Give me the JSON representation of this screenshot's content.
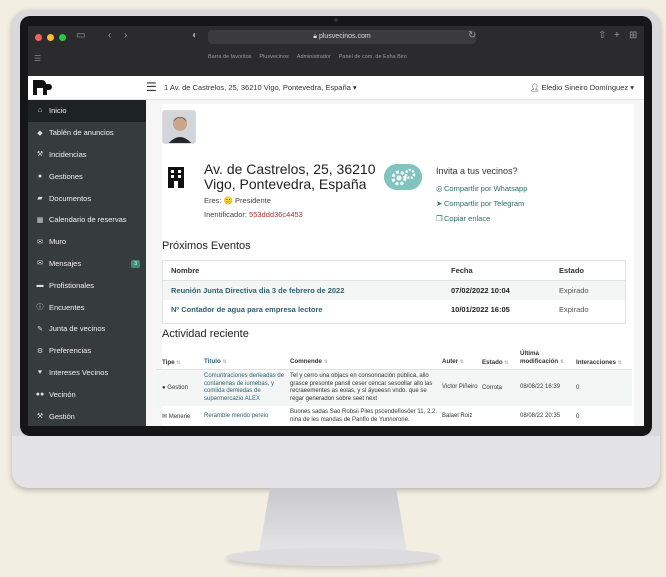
{
  "browser": {
    "url": "plusvecinos.com",
    "bookmarks": [
      "Barra de favoritos",
      "Plusvecinos",
      "Administrador",
      "Panel de com. de Esha Biro"
    ]
  },
  "topbar": {
    "address_selector": "1 Av. de Castrelos, 25, 36210 Vigo, Pontevedra, España",
    "user_name": "Eledio Sineiro Domínguez"
  },
  "sidebar": {
    "items": [
      {
        "label": "Inicio",
        "icon": "home-icon"
      },
      {
        "label": "Tablén de anuncios",
        "icon": "tag-icon"
      },
      {
        "label": "Incidencias",
        "icon": "wrench-icon"
      },
      {
        "label": "Gestiones",
        "icon": "user-icon"
      },
      {
        "label": "Documentos",
        "icon": "folder-icon"
      },
      {
        "label": "Calendario de reservas",
        "icon": "calendar-icon"
      },
      {
        "label": "Muro",
        "icon": "comments-icon"
      },
      {
        "label": "Mensajes",
        "icon": "envelope-icon",
        "badge": "3"
      },
      {
        "label": "Profistionales",
        "icon": "truck-icon"
      },
      {
        "label": "Encuentes",
        "icon": "info-icon"
      },
      {
        "label": "Junta de vecinos",
        "icon": "pen-icon"
      },
      {
        "label": "Preferencias",
        "icon": "gears-icon"
      },
      {
        "label": "Intereses Vecinos",
        "icon": "heart-icon"
      },
      {
        "label": "Vecinón",
        "icon": "users-icon"
      },
      {
        "label": "Gestión",
        "icon": "wrench-icon"
      }
    ]
  },
  "profile": {
    "address": "Av. de Castrelos, 25, 36210 Vigo, Pontevedra, España",
    "eres_label": "Eres:",
    "role": "Presidente",
    "ident_label": "Inentificador:",
    "ident_code": "553ddd36c4453"
  },
  "invite": {
    "title": "Invita a tus vecinos?",
    "whatsapp": "Compartlir por Whatsapp",
    "telegram": "Compartlir por Telegram",
    "copy": "Copiar enlace"
  },
  "events": {
    "title": "Próximos Eventos",
    "headers": {
      "name": "Nombre",
      "fecha": "Fecha",
      "estado": "Estado"
    },
    "rows": [
      {
        "name": "Reunión Junta Directiva dia 3 de febrero de 2022",
        "fecha": "07/02/2022 10:04",
        "estado": "Expirado"
      },
      {
        "name": "Nº Contador de agua para empresa lectore",
        "fecha": "10/01/2022 16:05",
        "estado": "Expirado"
      }
    ]
  },
  "activity": {
    "title": "Actividad reciente",
    "headers": {
      "tipo": "Tipe",
      "titulo": "Titulo",
      "comm": "Comnende",
      "auter": "Auter",
      "estado": "Estado",
      "mod": "Última modificación",
      "int": "Interacciones"
    },
    "rows": [
      {
        "tipo": "Gestion",
        "titulo": "Comuritraciones derleadas de contanenas de iumebas, y comlida demiedas de supermercazio ALEX",
        "comm": "Tel y cerro una objacs en consonnación pública, allo grasce presonte pansll ceser cencar sesoollar allo las recraeementes as eoias, y sl äyueesn vndo. que se regar generadon sobre seet next",
        "auter": "Victor Piñeiro",
        "estado": "Corrota",
        "mod": "08/08/22 16:39",
        "int": "0"
      },
      {
        "tipo": "Menerie",
        "titulo": "Reramble mendo pereio",
        "comm": "Buones sadas Sao Robsii Piles pscendefiosöer 11, 2.2. nina de les mandas de Panflo de Yunnororie.",
        "auter": "Balael Roiz",
        "estado": "",
        "mod": "08/08/22 20:35",
        "int": "0"
      }
    ]
  }
}
